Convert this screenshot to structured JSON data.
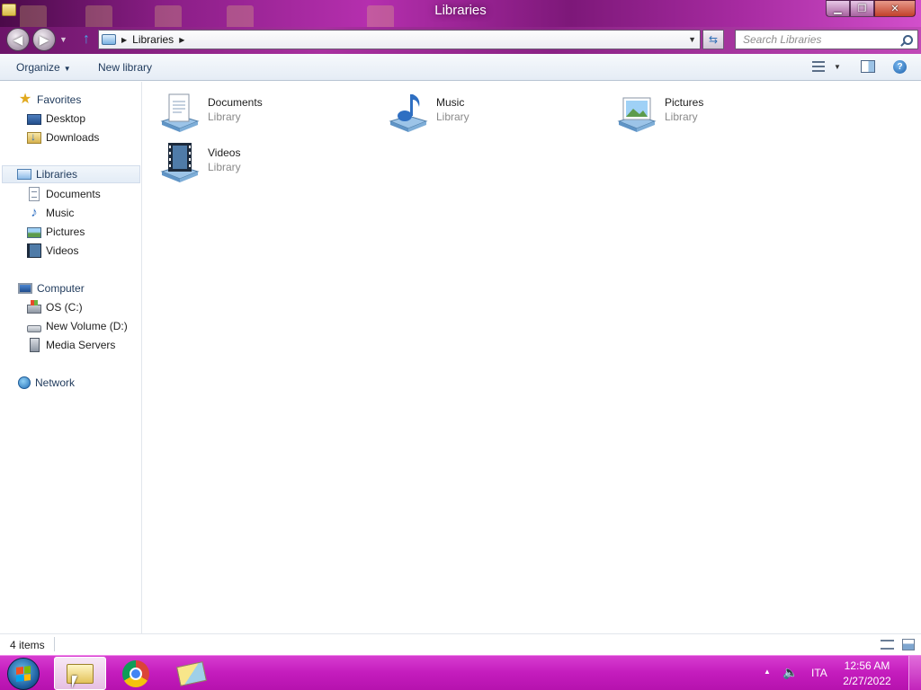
{
  "window": {
    "title": "Libraries",
    "minimize_icon": "minimize-icon",
    "maximize_icon": "restore-icon",
    "close_icon": "close-icon",
    "accent_color": "#b52fae"
  },
  "address_bar": {
    "breadcrumb": [
      "Libraries"
    ],
    "search_placeholder": "Search Libraries"
  },
  "command_bar": {
    "organize_label": "Organize",
    "new_library_label": "New library"
  },
  "nav_pane": {
    "favorites": {
      "label": "Favorites",
      "items": [
        {
          "label": "Desktop",
          "icon": "desktop-icon"
        },
        {
          "label": "Downloads",
          "icon": "downloads-icon"
        }
      ]
    },
    "libraries": {
      "label": "Libraries",
      "selected": true,
      "items": [
        {
          "label": "Documents",
          "icon": "document-icon"
        },
        {
          "label": "Music",
          "icon": "music-icon"
        },
        {
          "label": "Pictures",
          "icon": "picture-icon"
        },
        {
          "label": "Videos",
          "icon": "video-icon"
        }
      ]
    },
    "computer": {
      "label": "Computer",
      "items": [
        {
          "label": "OS (C:)",
          "icon": "drive-icon"
        },
        {
          "label": "New Volume (D:)",
          "icon": "drive-icon"
        },
        {
          "label": "Media Servers",
          "icon": "server-icon"
        }
      ]
    },
    "network": {
      "label": "Network"
    }
  },
  "libraries": [
    {
      "name": "Documents",
      "type": "Library",
      "icon": "documents-library-icon"
    },
    {
      "name": "Music",
      "type": "Library",
      "icon": "music-library-icon"
    },
    {
      "name": "Pictures",
      "type": "Library",
      "icon": "pictures-library-icon"
    },
    {
      "name": "Videos",
      "type": "Library",
      "icon": "videos-library-icon"
    }
  ],
  "status_bar": {
    "item_count": "4 items"
  },
  "taskbar": {
    "items": [
      "Windows Explorer",
      "Google Chrome",
      "Folder"
    ],
    "language": "ITA",
    "time": "12:56 AM",
    "date": "2/27/2022"
  }
}
